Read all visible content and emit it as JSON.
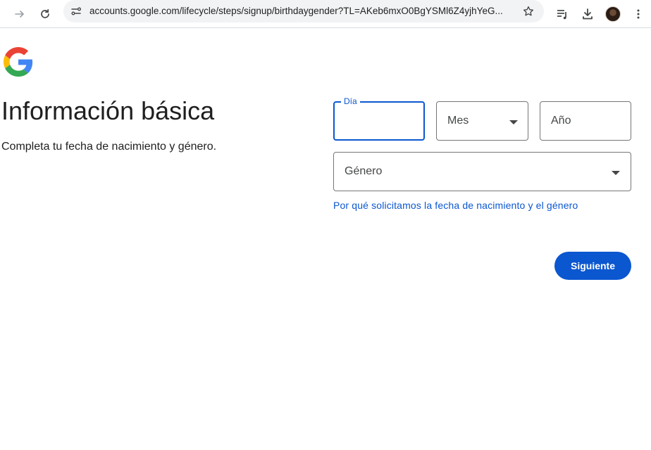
{
  "browser": {
    "url": "accounts.google.com/lifecycle/steps/signup/birthdaygender?TL=AKeb6mxO0BgYSMl6Z4yjhYeG...",
    "icons": [
      "forward-icon",
      "reload-icon",
      "site-info-icon",
      "bookmark-star-icon",
      "reading-list-icon",
      "download-icon",
      "profile-avatar",
      "more-menu-icon"
    ]
  },
  "page": {
    "title": "Información básica",
    "subtitle": "Completa tu fecha de nacimiento y género.",
    "day_label": "Día",
    "month_placeholder": "Mes",
    "year_placeholder": "Año",
    "gender_placeholder": "Género",
    "help_link": "Por qué solicitamos la fecha de nacimiento y el género",
    "next_button": "Siguiente"
  },
  "colors": {
    "accent": "#0b57d0",
    "border": "#747775",
    "text": "#1f1f1f"
  }
}
